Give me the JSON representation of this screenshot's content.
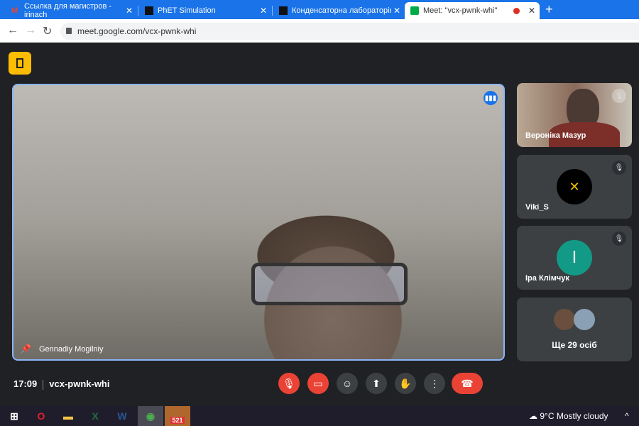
{
  "browser": {
    "tabs": [
      {
        "title": "Ссылка для магистров - irinach"
      },
      {
        "title": "PhET Simulation"
      },
      {
        "title": "Конденсаторна лабораторія - I"
      },
      {
        "title": "Meet: \"vcx-pwnk-whi\""
      }
    ],
    "url": "meet.google.com/vcx-pwnk-whi",
    "new_tab": "+",
    "close": "✕"
  },
  "main_video": {
    "name": "Gennadiy Mogilniy"
  },
  "participants": [
    {
      "name": "Вероніка Мазур"
    },
    {
      "name": "Viki_S"
    },
    {
      "name": "Іра Клімчук",
      "initial": "I"
    }
  ],
  "more": {
    "label": "Ще 29 осіб"
  },
  "meeting": {
    "time": "17:09",
    "code": "vcx-pwnk-whi"
  },
  "taskbar": {
    "telegram_badge": "521",
    "weather": "9°C  Mostly cloudy",
    "tray": "^"
  },
  "colors": {
    "accent": "#1a73e8",
    "danger": "#ea4335",
    "avatar_teal": "#129a86"
  }
}
